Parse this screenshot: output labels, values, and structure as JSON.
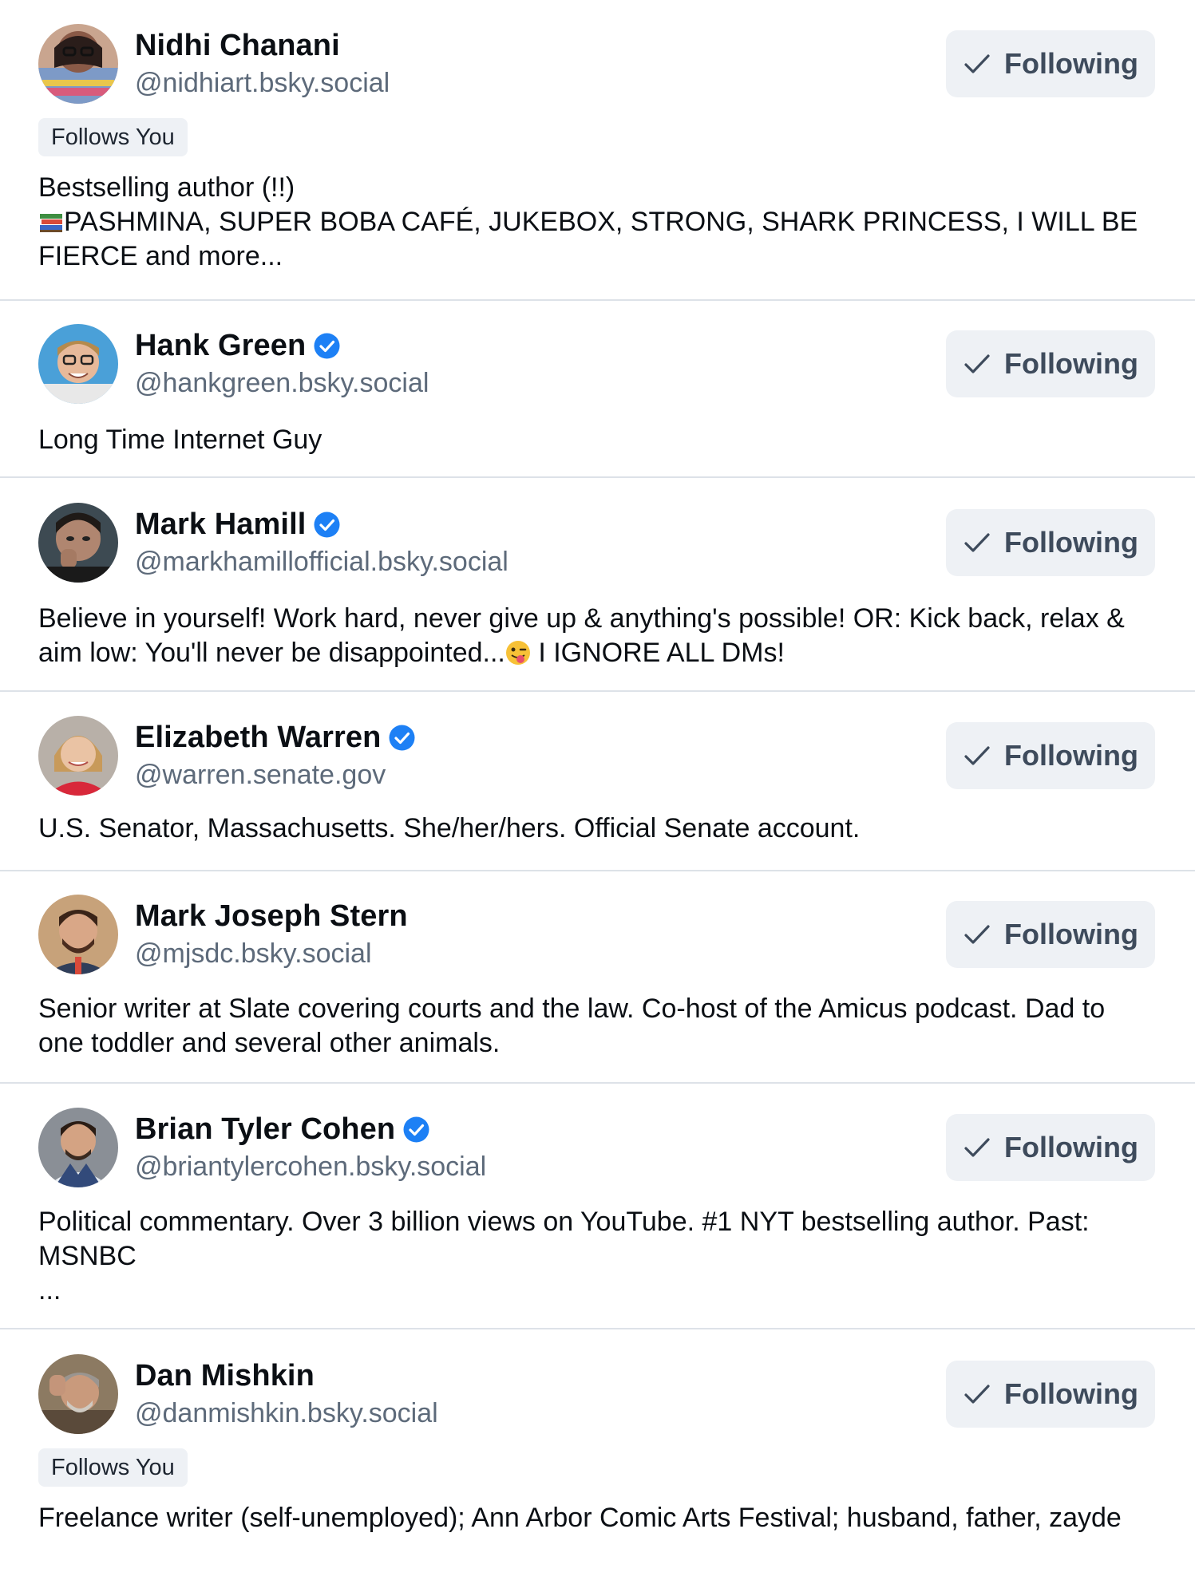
{
  "follow_label": "Following",
  "follows_you_label": "Follows You",
  "colors": {
    "verified": "#1d80f5",
    "button_bg": "#eef1f5",
    "handle": "#5d6a7a",
    "divider": "#dde2e8"
  },
  "users": [
    {
      "name": "Nidhi Chanani",
      "handle": "@nidhiart.bsky.social",
      "verified": false,
      "follows_you": true,
      "bio_emoji": "books-emoji",
      "bio_line1": "Bestselling author (!!)",
      "bio_line2": "PASHMINA, SUPER BOBA CAFÉ, JUKEBOX, STRONG, SHARK PRINCESS, I WILL BE FIERCE and more..."
    },
    {
      "name": "Hank Green",
      "handle": "@hankgreen.bsky.social",
      "verified": true,
      "follows_you": false,
      "bio": "Long Time Internet Guy"
    },
    {
      "name": "Mark Hamill",
      "handle": "@markhamillofficial.bsky.social",
      "verified": true,
      "follows_you": false,
      "bio_part1": "Believe in yourself! Work hard, never give up & anything's possible! OR: Kick back, relax & aim low: You'll never be disappointed...",
      "bio_emoji": "winking-tongue-emoji",
      "bio_part2": " I IGNORE ALL DMs!"
    },
    {
      "name": "Elizabeth Warren",
      "handle": "@warren.senate.gov",
      "verified": true,
      "follows_you": false,
      "bio": "U.S. Senator, Massachusetts. She/her/hers. Official Senate account."
    },
    {
      "name": "Mark Joseph Stern",
      "handle": "@mjsdc.bsky.social",
      "verified": false,
      "follows_you": false,
      "bio": "Senior writer at Slate covering courts and the law. Co-host of the Amicus podcast. Dad to one toddler and several other animals."
    },
    {
      "name": "Brian Tyler Cohen",
      "handle": "@briantylercohen.bsky.social",
      "verified": true,
      "follows_you": false,
      "bio": "Political commentary. Over 3 billion views on YouTube. #1 NYT bestselling author. Past: MSNBC\n..."
    },
    {
      "name": "Dan Mishkin",
      "handle": "@danmishkin.bsky.social",
      "verified": false,
      "follows_you": true,
      "bio": "Freelance writer (self-unemployed); Ann Arbor Comic Arts Festival; husband, father, zayde"
    }
  ]
}
